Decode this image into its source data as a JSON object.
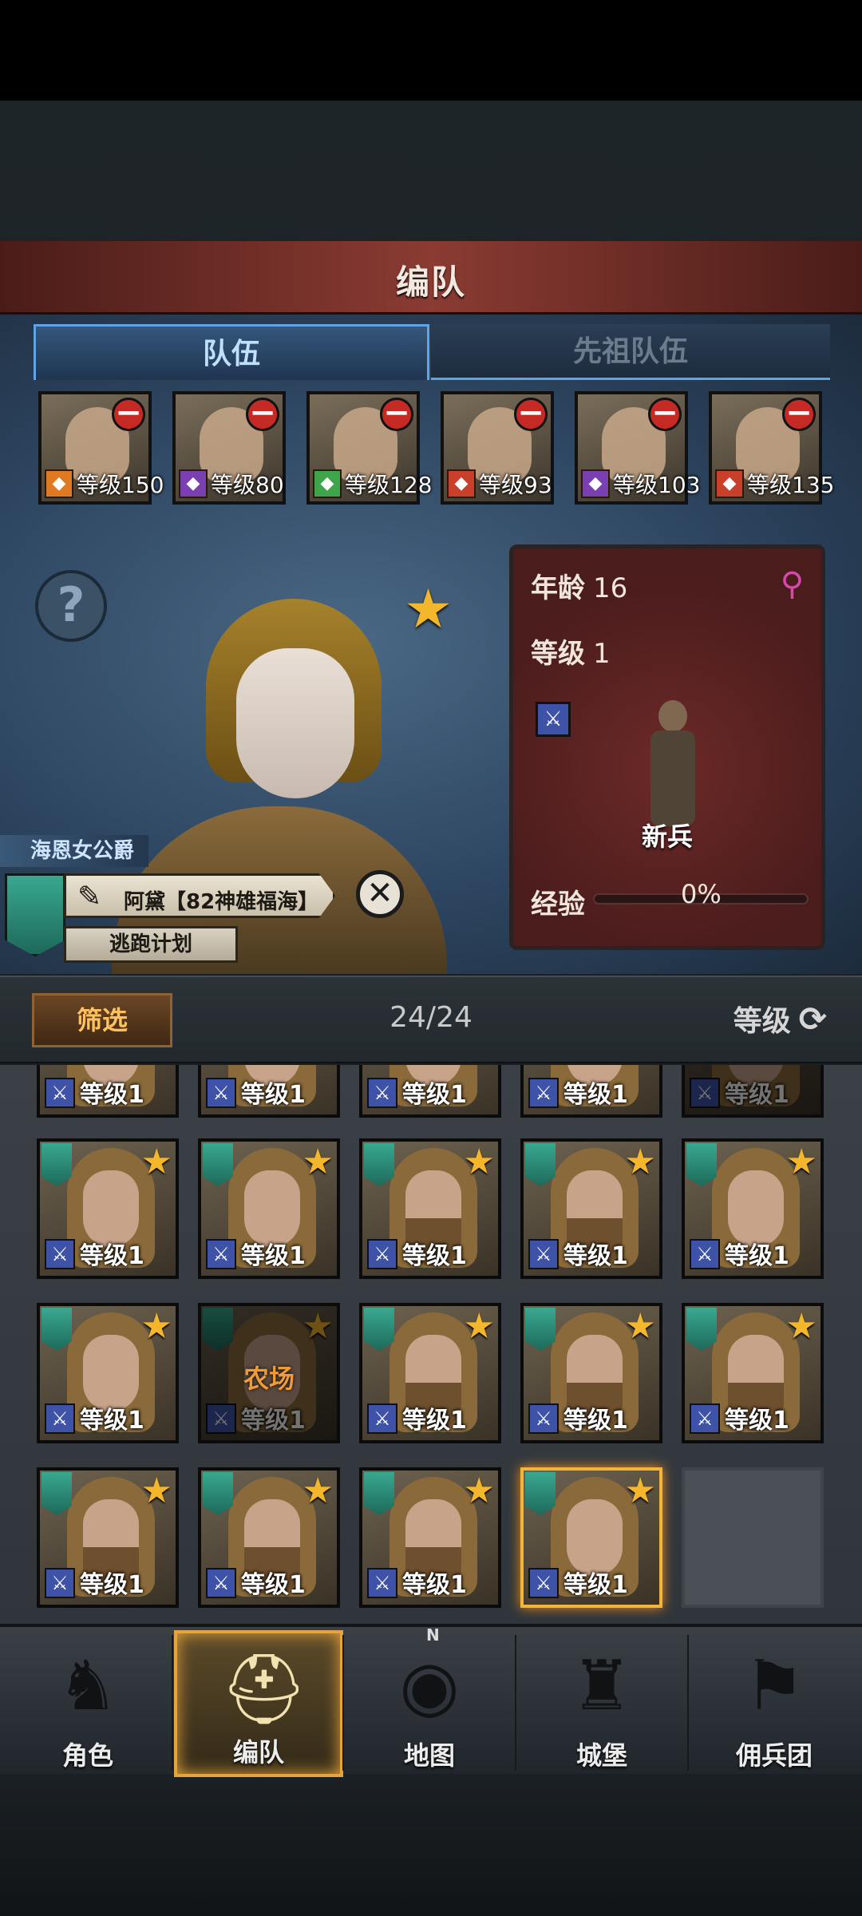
{
  "header": {
    "title": "编队"
  },
  "tabs": [
    {
      "label": "队伍",
      "active": true
    },
    {
      "label": "先祖队伍",
      "active": false
    }
  ],
  "party": [
    {
      "level": "等级150",
      "class_icon": "horse-icon",
      "class_color": "#e07a22"
    },
    {
      "level": "等级80",
      "class_icon": "staff-icon",
      "class_color": "#7a3fb0"
    },
    {
      "level": "等级128",
      "class_icon": "bow-icon",
      "class_color": "#3ea54a"
    },
    {
      "level": "等级93",
      "class_icon": "horse-icon",
      "class_color": "#c8402a"
    },
    {
      "level": "等级103",
      "class_icon": "staff-icon",
      "class_color": "#7a3fb0"
    },
    {
      "level": "等级135",
      "class_icon": "horse-icon",
      "class_color": "#c8402a"
    }
  ],
  "character": {
    "age_label": "年龄",
    "age": "16",
    "level_label": "等级",
    "level": "1",
    "class_name": "新兵",
    "xp_label": "经验",
    "xp": "0%",
    "xp_fraction": 0,
    "title": "海恩女公爵",
    "name": "阿黛【82神雄福海】",
    "plan": "逃跑计划",
    "gender_icon": "female-symbol-icon"
  },
  "filter": {
    "button": "筛选",
    "count": "24/24",
    "sort": "等级"
  },
  "roster": {
    "rows": [
      [
        {
          "level": "等级1",
          "partial": true
        },
        {
          "level": "等级1",
          "partial": true
        },
        {
          "level": "等级1",
          "partial": true
        },
        {
          "level": "等级1",
          "partial": true
        },
        {
          "level": "等级1",
          "partial": true,
          "dim": true
        }
      ],
      [
        {
          "level": "等级1",
          "beard": false
        },
        {
          "level": "等级1",
          "beard": false
        },
        {
          "level": "等级1",
          "beard": true
        },
        {
          "level": "等级1",
          "beard": true
        },
        {
          "level": "等级1",
          "beard": false
        }
      ],
      [
        {
          "level": "等级1",
          "beard": false
        },
        {
          "level": "等级1",
          "dim": true,
          "status": "农场"
        },
        {
          "level": "等级1",
          "beard": true
        },
        {
          "level": "等级1",
          "beard": true
        },
        {
          "level": "等级1",
          "beard": true
        }
      ],
      [
        {
          "level": "等级1",
          "beard": true
        },
        {
          "level": "等级1",
          "beard": true
        },
        {
          "level": "等级1",
          "beard": true
        },
        {
          "level": "等级1",
          "beard": false,
          "selected": true
        },
        {
          "empty": true
        }
      ]
    ]
  },
  "nav": [
    {
      "label": "角色",
      "icon": "knight-icon"
    },
    {
      "label": "编队",
      "icon": "helmet-icon",
      "active": true
    },
    {
      "label": "地图",
      "icon": "compass-icon"
    },
    {
      "label": "城堡",
      "icon": "castle-icon"
    },
    {
      "label": "佣兵团",
      "icon": "mercenary-icon"
    }
  ],
  "map_compass_letter": "N"
}
